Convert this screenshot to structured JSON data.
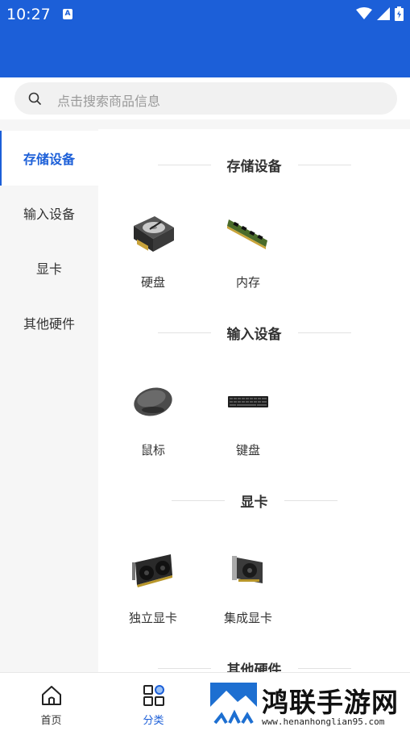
{
  "status_bar": {
    "time": "10:27",
    "notification_badge": "A"
  },
  "search": {
    "placeholder": "点击搜索商品信息"
  },
  "categories": [
    {
      "label": "存储设备",
      "active": true
    },
    {
      "label": "输入设备",
      "active": false
    },
    {
      "label": "显卡",
      "active": false
    },
    {
      "label": "其他硬件",
      "active": false
    }
  ],
  "sections": [
    {
      "title": "存储设备",
      "items": [
        {
          "name": "硬盘",
          "icon": "hard-drive-icon"
        },
        {
          "name": "内存",
          "icon": "ram-stick-icon"
        }
      ]
    },
    {
      "title": "输入设备",
      "items": [
        {
          "name": "鼠标",
          "icon": "mouse-icon"
        },
        {
          "name": "键盘",
          "icon": "keyboard-icon"
        }
      ]
    },
    {
      "title": "显卡",
      "items": [
        {
          "name": "独立显卡",
          "icon": "graphics-card-icon"
        },
        {
          "name": "集成显卡",
          "icon": "integrated-gpu-icon"
        }
      ]
    },
    {
      "title": "其他硬件",
      "items": []
    }
  ],
  "bottom_nav": [
    {
      "label": "首页",
      "icon": "home-icon",
      "active": false
    },
    {
      "label": "分类",
      "icon": "category-grid-icon",
      "active": true
    }
  ],
  "watermark": {
    "title": "鸿联手游网",
    "url": "www.henanhonglian95.com"
  },
  "colors": {
    "accent": "#1c5fd8",
    "background": "#ffffff",
    "sidebar": "#f6f6f6"
  }
}
